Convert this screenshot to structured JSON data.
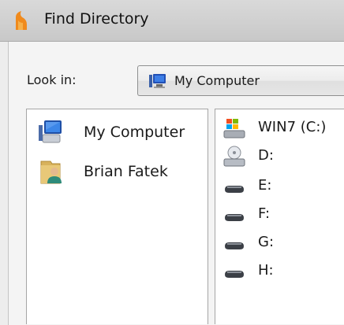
{
  "window": {
    "title": "Find Directory",
    "app_icon": "flame-app-icon"
  },
  "look_in": {
    "label": "Look in:",
    "value": "My Computer",
    "icon": "computer-icon"
  },
  "places": [
    {
      "label": "My Computer",
      "icon": "computer-icon"
    },
    {
      "label": "Brian Fatek",
      "icon": "user-folder-icon"
    }
  ],
  "drives": [
    {
      "label": "WIN7 (C:)",
      "icon": "windows-drive-icon"
    },
    {
      "label": "D:",
      "icon": "optical-drive-icon"
    },
    {
      "label": "E:",
      "icon": "removable-drive-icon"
    },
    {
      "label": "F:",
      "icon": "removable-drive-icon"
    },
    {
      "label": "G:",
      "icon": "removable-drive-icon"
    },
    {
      "label": "H:",
      "icon": "removable-drive-icon"
    }
  ],
  "colors": {
    "title_bar": "#cfcfcf",
    "panel_border": "#a5a5a5",
    "accent_orange": "#f08a1c",
    "monitor_blue": "#2f6fd1"
  }
}
